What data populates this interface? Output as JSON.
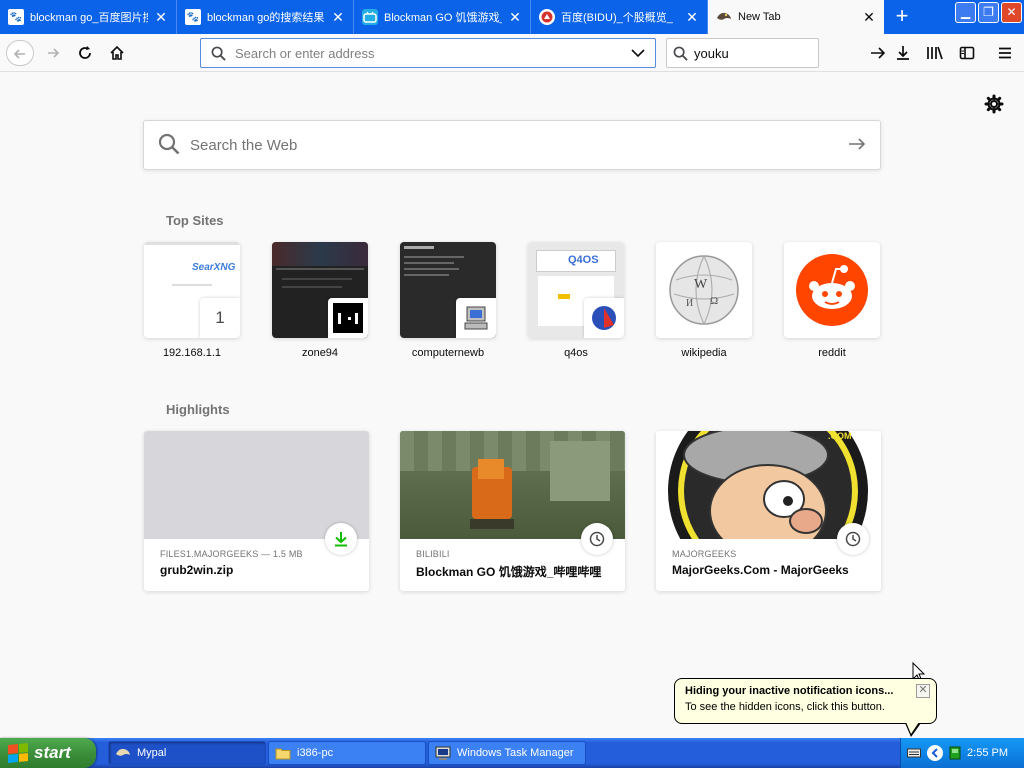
{
  "tabs": [
    {
      "title": "blockman go_百度图片搜",
      "favicon": "baidu-icon",
      "active": false
    },
    {
      "title": "blockman go的搜索结果",
      "favicon": "baidu-icon",
      "active": false
    },
    {
      "title": "Blockman GO 饥饿游戏_",
      "favicon": "bilibili-icon",
      "active": false
    },
    {
      "title": "百度(BIDU)_个股概览_",
      "favicon": "xueqiu-icon",
      "active": false
    },
    {
      "title": "New Tab",
      "favicon": "mypal-icon",
      "active": true
    }
  ],
  "newtab_label": "+",
  "nav": {
    "url_placeholder": "Search or enter address",
    "url_value": "",
    "search_value": "youku"
  },
  "main": {
    "web_search_placeholder": "Search the Web",
    "top_sites_title": "Top Sites",
    "top_sites": [
      {
        "label": "192.168.1.1",
        "badge": "1",
        "thumb_text": "SearXNG"
      },
      {
        "label": "zone94"
      },
      {
        "label": "computernewb"
      },
      {
        "label": "q4os",
        "thumb_text": "Q4OS"
      },
      {
        "label": "wikipedia"
      },
      {
        "label": "reddit"
      }
    ],
    "highlights_title": "Highlights",
    "highlights": [
      {
        "source": "FILES1.MAJORGEEKS — 1.5 MB",
        "title": "grub2win.zip",
        "badge": "download-icon"
      },
      {
        "source": "BILIBILI",
        "title": "Blockman GO 饥饿游戏_哔哩哔哩",
        "badge": "clock-icon"
      },
      {
        "source": "MAJORGEEKS",
        "title": "MajorGeeks.Com - MajorGeeks",
        "badge": "clock-icon",
        "thumb_text": ".COM"
      }
    ]
  },
  "balloon": {
    "title": "Hiding your inactive notification icons...",
    "body": "To see the hidden icons, click this button."
  },
  "taskbar": {
    "start_label": "start",
    "items": [
      {
        "label": "Mypal",
        "active": true
      },
      {
        "label": "i386-pc",
        "active": false
      },
      {
        "label": "Windows Task Manager",
        "active": false
      }
    ],
    "clock": "2:55 PM"
  },
  "colors": {
    "titlebar": "#0a63e8",
    "page_bg": "#f9f9fa",
    "reddit": "#ff4500",
    "download_green": "#12bc00",
    "taskbar_blue": "#245edb",
    "start_green": "#3c8f3b"
  }
}
